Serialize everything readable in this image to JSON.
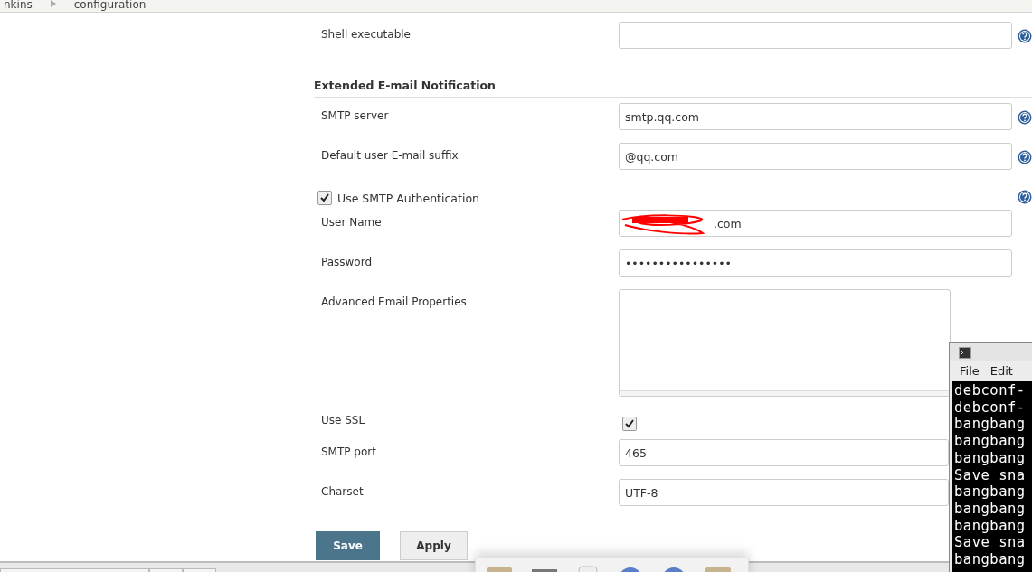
{
  "breadcrumb": [
    "nkins",
    "configuration"
  ],
  "rows": [
    {
      "kind": "field",
      "label": "Shell executable",
      "value": "",
      "help": true
    },
    {
      "kind": "heading",
      "label": "Extended E-mail Notification"
    },
    {
      "kind": "field",
      "label": "SMTP server",
      "value": "smtp.qq.com",
      "help": true
    },
    {
      "kind": "field",
      "label": "Default user E-mail suffix",
      "value": "@qq.com",
      "help": true
    },
    {
      "kind": "checkbox",
      "label": "Use SMTP Authentication",
      "checked": true,
      "help": true
    },
    {
      "kind": "redacted",
      "label": "User Name",
      "value": ".com",
      "help": false
    },
    {
      "kind": "field",
      "label": "Password",
      "value": "••••••••••••••••",
      "help": false
    },
    {
      "kind": "textarea",
      "label": "Advanced Email Properties",
      "value": "",
      "help": false
    },
    {
      "kind": "check",
      "label": "Use SSL",
      "checked": true,
      "help": false
    },
    {
      "kind": "field",
      "label": "SMTP port",
      "value": "465",
      "help": false
    },
    {
      "kind": "field",
      "label": "Charset",
      "value": "UTF-8",
      "help": false
    }
  ],
  "buttons": [
    {
      "label": "Save",
      "kind": "primary"
    },
    {
      "label": "Apply",
      "kind": "secondary"
    }
  ],
  "terminal": {
    "menu": [
      "File",
      "Edit"
    ],
    "lines": [
      "debconf-",
      "debconf-",
      "bangbang",
      "bangbang",
      "bangbang",
      "Save sna",
      "bangbang",
      "bangbang",
      "bangbang",
      "Save sna",
      "bangbang"
    ]
  }
}
